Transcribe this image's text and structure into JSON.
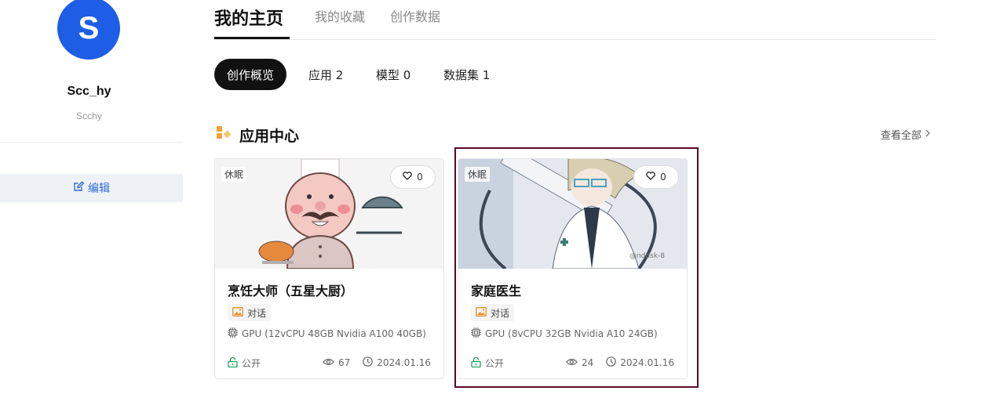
{
  "profile": {
    "avatar_letter": "S",
    "username": "Scc_hy",
    "handle": "Scchy",
    "edit_label": "编辑"
  },
  "top_tabs": [
    {
      "label": "我的主页",
      "active": true
    },
    {
      "label": "我的收藏",
      "active": false
    },
    {
      "label": "创作数据",
      "active": false
    }
  ],
  "sub_tabs": [
    {
      "label": "创作概览",
      "active": true
    },
    {
      "label": "应用 2",
      "active": false
    },
    {
      "label": "模型 0",
      "active": false
    },
    {
      "label": "数据集 1",
      "active": false
    }
  ],
  "section": {
    "title": "应用中心",
    "view_all": "查看全部"
  },
  "cards": [
    {
      "status": "休眠",
      "likes": "0",
      "title": "烹饪大师（五星大厨）",
      "tag": "对话",
      "gpu": "GPU (12vCPU 48GB Nvidia A100 40GB)",
      "visibility": "公开",
      "views": "67",
      "date": "2024.01.16",
      "image": "chef-cartoon"
    },
    {
      "status": "休眠",
      "likes": "0",
      "title": "家庭医生",
      "tag": "对话",
      "gpu": "GPU (8vCPU 32GB Nvidia A10 24GB)",
      "visibility": "公开",
      "views": "24",
      "date": "2024.01.16",
      "image": "anime-doctor"
    }
  ],
  "colors": {
    "accent_blue": "#1e5ee6",
    "public_green": "#19a35c",
    "tag_orange": "#e8912d",
    "highlight_border": "#5a0c22"
  }
}
